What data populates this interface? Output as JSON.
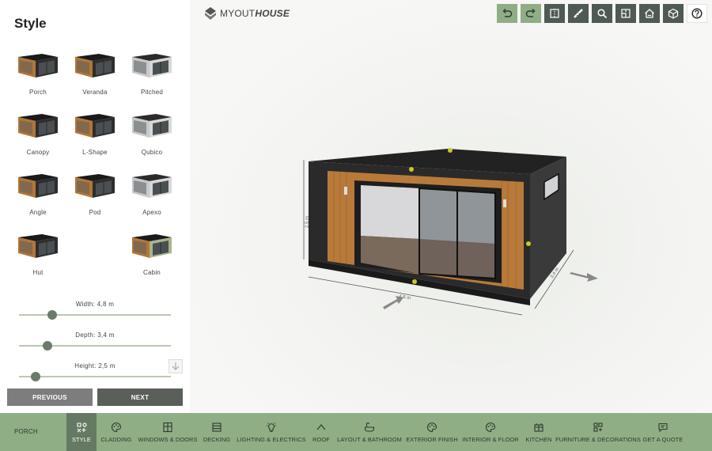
{
  "logo": {
    "prefix": "MYOUT",
    "suffix": "HOUSE"
  },
  "panel": {
    "title": "Style",
    "styles": [
      {
        "label": "Porch",
        "variant": "dark"
      },
      {
        "label": "Veranda",
        "variant": "dark"
      },
      {
        "label": "Pitched",
        "variant": "light"
      },
      {
        "label": "Canopy",
        "variant": "dark"
      },
      {
        "label": "L-Shape",
        "variant": "dark"
      },
      {
        "label": "Qubico",
        "variant": "light"
      },
      {
        "label": "Angle",
        "variant": "dark"
      },
      {
        "label": "Pod",
        "variant": "dark"
      },
      {
        "label": "Apexo",
        "variant": "light"
      },
      {
        "label": "Hut",
        "variant": "dark"
      },
      {
        "label": "",
        "variant": "none"
      },
      {
        "label": "Cabin",
        "variant": "green"
      }
    ],
    "sliders": [
      {
        "label": "Width:  4,8  m",
        "fraction": 0.22
      },
      {
        "label": "Depth:  3,4  m",
        "fraction": 0.19
      },
      {
        "label": "Height:  2,5  m",
        "fraction": 0.11
      }
    ],
    "previous_label": "PREVIOUS",
    "next_label": "NEXT"
  },
  "toolbar": [
    "undo-icon",
    "redo-icon",
    "mirror-icon",
    "measure-icon",
    "zoom-icon",
    "floorplan-icon",
    "house-view-icon",
    "3d-cube-icon",
    "help-icon"
  ],
  "model": {
    "dim_height": "2,5 m",
    "dim_width": "4,8 m",
    "dim_depth": "3,4 m"
  },
  "bottombar": {
    "current": "PORCH",
    "tabs": [
      {
        "label": "STYLE",
        "icon": "style-icon",
        "active": true
      },
      {
        "label": "CLADDING",
        "icon": "palette-icon",
        "active": false
      },
      {
        "label": "WINDOWS & DOORS",
        "icon": "window-icon",
        "active": false
      },
      {
        "label": "DECKING",
        "icon": "decking-icon",
        "active": false
      },
      {
        "label": "LIGHTING & ELECTRICS",
        "icon": "bulb-icon",
        "active": false
      },
      {
        "label": "ROOF",
        "icon": "roof-icon",
        "active": false
      },
      {
        "label": "LAYOUT & BATHROOM",
        "icon": "bath-icon",
        "active": false
      },
      {
        "label": "EXTERIOR FINISH",
        "icon": "palette-icon",
        "active": false
      },
      {
        "label": "INTERIOR & FLOOR",
        "icon": "palette-icon",
        "active": false
      },
      {
        "label": "KITCHEN",
        "icon": "kitchen-icon",
        "active": false
      },
      {
        "label": "FURNITURE & DECORATIONS",
        "icon": "furniture-icon",
        "active": false
      },
      {
        "label": "GET A QUOTE",
        "icon": "quote-icon",
        "active": false
      }
    ]
  },
  "colors": {
    "accent_green": "#8fae86",
    "active_green": "#657a63",
    "dark_button": "#5a5f5a"
  }
}
